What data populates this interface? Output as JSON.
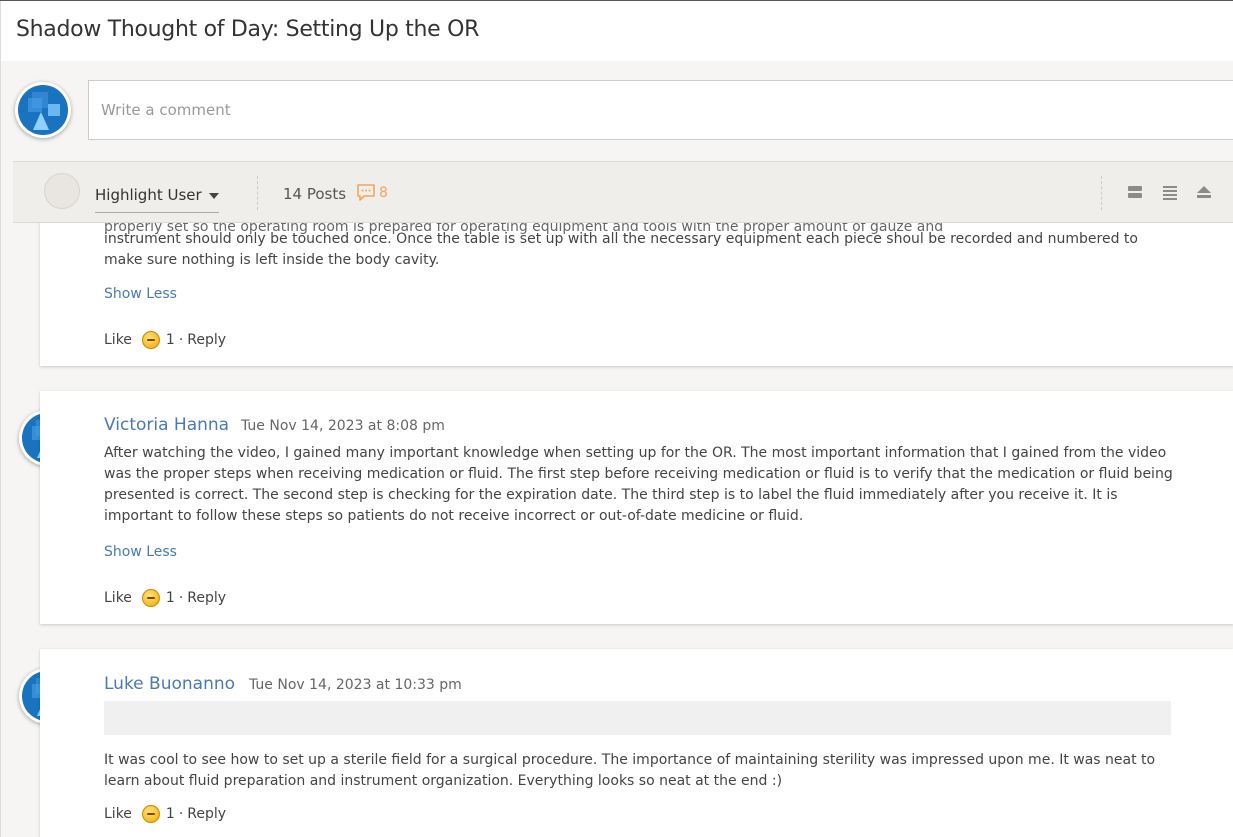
{
  "page": {
    "title": "Shadow Thought of Day: Setting Up the OR"
  },
  "composer": {
    "placeholder": "Write a comment"
  },
  "toolbar": {
    "highlight_label": "Highlight User",
    "posts_label": "14 Posts",
    "comment_count": "8",
    "views": [
      "card-view-icon",
      "list-view-icon",
      "collapse-view-icon"
    ]
  },
  "posts": [
    {
      "partial_top_line": "properly set so the operating room is prepared for operating equipment and tools with the proper amount of gauze and",
      "body": "instrument should only be touched once. Once the table is set up with all the necessary equipment each piece shoul be recorded and numbered to make sure nothing is left inside the body cavity.",
      "show_less": "Show Less",
      "like": "Like",
      "reactions": "1",
      "sep": "·",
      "reply": "Reply"
    },
    {
      "author": "Victoria Hanna",
      "date": "Tue Nov 14, 2023 at 8:08 pm",
      "body": "After watching the video, I gained many important knowledge when setting up for the OR. The most important information that I gained from the video was the proper steps when receiving medication or fluid. The first step before receiving medication or fluid is to verify that the medication or fluid being presented is correct. The second step is checking for the expiration date. The third step is to label the fluid immediately after you receive it. It is important to follow these steps so patients do not receive incorrect or out-of-date medicine or fluid.",
      "show_less": "Show Less",
      "like": "Like",
      "reactions": "1",
      "sep": "·",
      "reply": "Reply"
    },
    {
      "author": "Luke Buonanno",
      "date": "Tue Nov 14, 2023 at 10:33 pm",
      "body": "It was cool to see how to set up a sterile field for a surgical procedure. The importance of maintaining sterility was impressed upon me. It was neat to learn about fluid preparation and instrument organization. Everything looks so neat at the end :)",
      "like": "Like",
      "reactions": "1",
      "sep": "·",
      "reply": "Reply"
    }
  ],
  "colors": {
    "accent": "#4a7ab3",
    "chat_icon": "#f0a55b",
    "avatar_blue": "#1a73bf"
  }
}
